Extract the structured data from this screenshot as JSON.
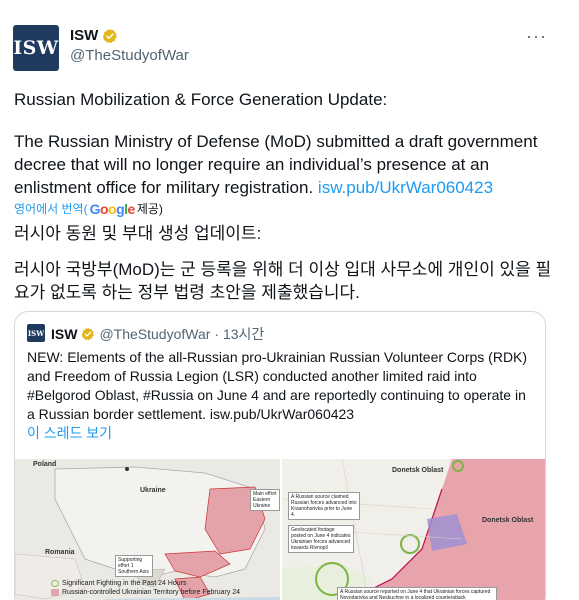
{
  "author": {
    "avatar_text": "ISW",
    "name": "ISW",
    "handle": "@TheStudyofWar",
    "more_icon": "more-dots-icon",
    "badge_color": "#e2b719"
  },
  "tweet": {
    "line1": "Russian Mobilization & Force Generation Update:",
    "para_text": "The Russian Ministry of Defense (MoD) submitted a draft government decree that will no longer require an individual’s presence at an enlistment office for military registration. ",
    "link": "isw.pub/UkrWar060423",
    "translate_prefix": "영어에서 번역(",
    "translate_suffix": " 제공)",
    "translated_line1": "러시아 동원 및 부대 생성 업데이트:",
    "translated_para": "러시아 국방부(MoD)는 군 등록을 위해 더 이상 입대 사무소에 개인이 있을 필요가 없도록 하는 정부 법령 초안을 제출했습니다."
  },
  "quote": {
    "avatar_text": "ISW",
    "name": "ISW",
    "handle": "@TheStudyofWar",
    "time": "· 13시간",
    "body": "NEW: Elements of the all-Russian pro-Ukrainian Russian Volunteer Corps (RDK) and Freedom of Russia Legion (LSR) conducted another limited raid into #Belgorod Oblast, #Russia on June 4 and are reportedly continuing to operate in a Russian border settlement. isw.pub/UkrWar060423",
    "show_thread": "이 스레드 보기"
  },
  "map_left": {
    "labels": [
      "Poland",
      "Ukraine",
      "Romania",
      "Main effort Eastern Ukraine",
      "Supporting effort 1 Southern Axis"
    ],
    "legend": [
      "Significant Fighting in the Past 24 Hours",
      "Russian-controlled Ukrainian Territory before February 24"
    ]
  },
  "map_right": {
    "labels": [
      "Donetsk Oblast",
      "Donetsk Oblast"
    ],
    "callouts": [
      "A Russian source claimed Russian forces advanced into Krasnohorivka prior to June 4.",
      "Geolocated footage posted on June 4 indicates Ukrainian forces advanced towards Rivnopil",
      "A Russian source reported on June 4 that Ukrainian forces captured Novodarivka and Neskuchne in a localized counterattack"
    ]
  }
}
